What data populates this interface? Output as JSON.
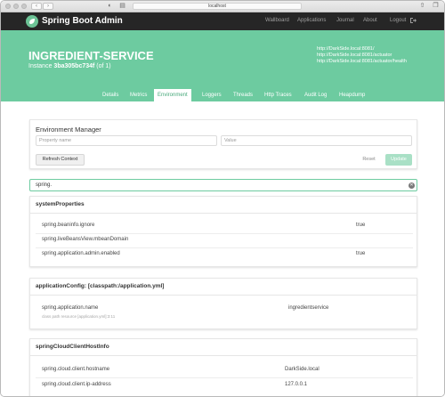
{
  "browser": {
    "url": "localhost",
    "back_icon": "chevron-left-icon",
    "forward_icon": "chevron-right-icon"
  },
  "topbar": {
    "brand": "Spring Boot Admin",
    "nav": [
      "Wallboard",
      "Applications",
      "Journal",
      "About",
      "Logout"
    ]
  },
  "header": {
    "service_name": "INGREDIENT-SERVICE",
    "instance_label": "Instance",
    "instance_id": "3ba305bc734f",
    "instance_count": "(of 1)",
    "links": [
      "http://DarkSide.local:8081/",
      "http://DarkSide.local:8081/actuator",
      "http://DarkSide.local:8081/actuator/health"
    ],
    "tabs": [
      "Details",
      "Metrics",
      "Environment",
      "Loggers",
      "Threads",
      "Http Traces",
      "Audit Log",
      "Heapdump"
    ],
    "active_tab": "Environment"
  },
  "env_manager": {
    "title": "Environment Manager",
    "property_placeholder": "Property name",
    "value_placeholder": "Value",
    "refresh_label": "Refresh Context",
    "reset_label": "Reset",
    "update_label": "Update"
  },
  "search": {
    "value": "spring."
  },
  "sections": [
    {
      "title": "systemProperties",
      "rows": [
        {
          "key": "spring.beaninfo.ignore",
          "value": "true"
        },
        {
          "key": "spring.liveBeansView.mbeanDomain",
          "value": ""
        },
        {
          "key": "spring.application.admin.enabled",
          "value": "true"
        }
      ]
    },
    {
      "title": "applicationConfig: [classpath:/application.yml]",
      "rows": [
        {
          "key": "spring.application.name",
          "value": "ingredientservice",
          "origin": "class path resource [application.yml]:3:11"
        }
      ]
    },
    {
      "title": "springCloudClientHostInfo",
      "rows": [
        {
          "key": "spring.cloud.client.hostname",
          "value": "DarkSide.local"
        },
        {
          "key": "spring.cloud.client.ip-address",
          "value": "127.0.0.1"
        }
      ]
    }
  ],
  "colors": {
    "accent": "#6dcba0",
    "topbar": "#262626"
  }
}
